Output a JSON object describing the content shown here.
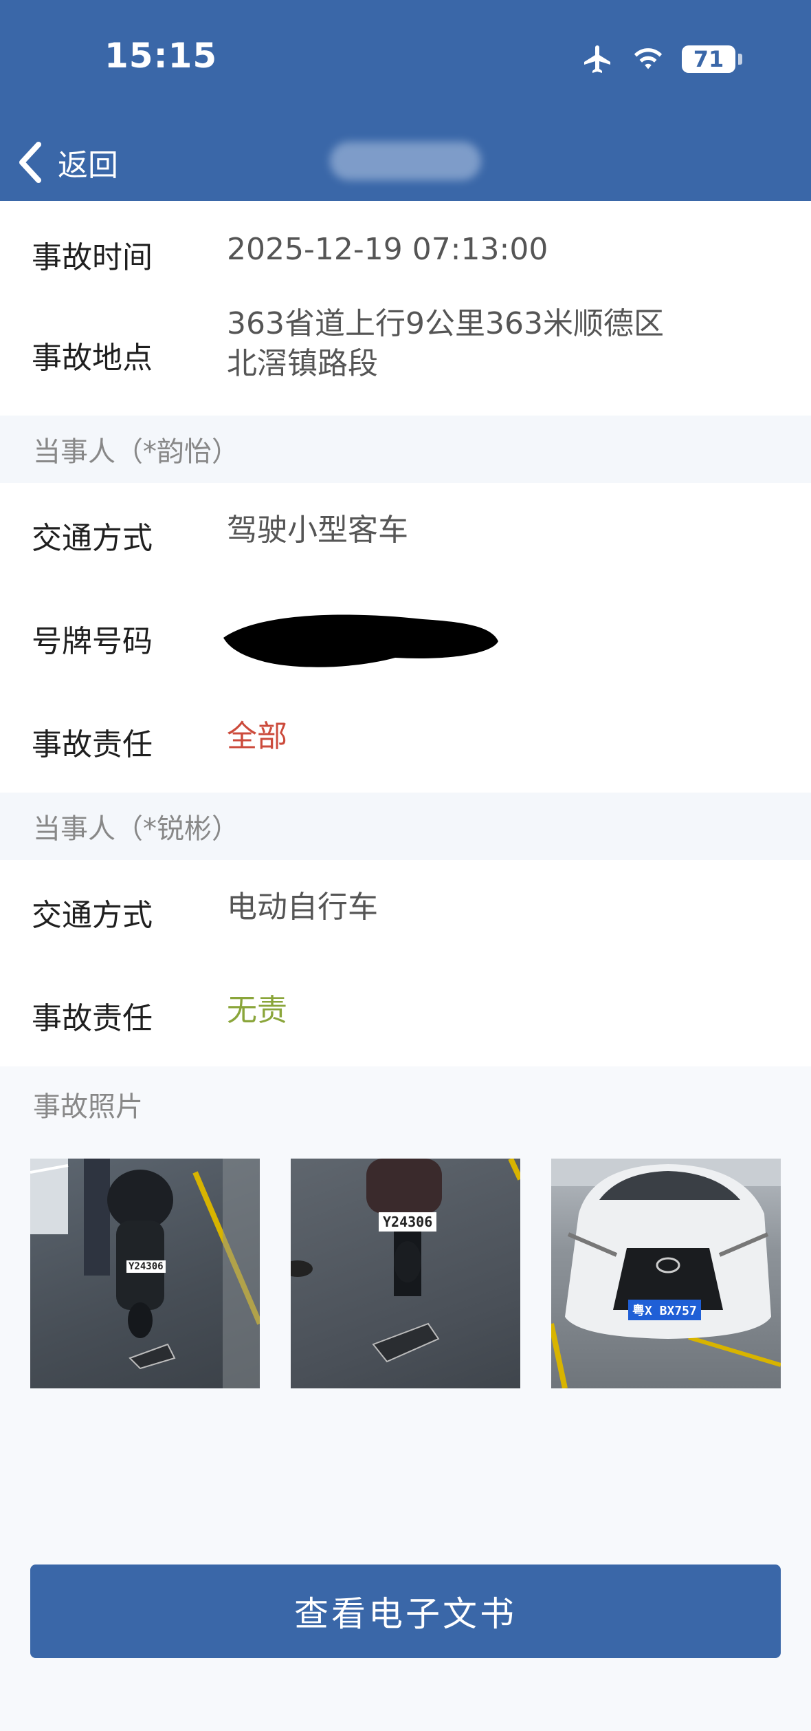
{
  "status_bar": {
    "time": "15:15",
    "battery": "71"
  },
  "nav": {
    "back_label": "返回"
  },
  "accident": {
    "time_label": "事故时间",
    "time_value": "2025-12-19 07:13:00",
    "location_label": "事故地点",
    "location_line1": "363省道上行9公里363米顺德区",
    "location_line2": "北滘镇路段"
  },
  "party1": {
    "header": "当事人（*韵怡）",
    "mode_label": "交通方式",
    "mode_value": "驾驶小型客车",
    "plate_label": "号牌号码",
    "liability_label": "事故责任",
    "liability_value": "全部"
  },
  "party2": {
    "header": "当事人（*锐彬）",
    "mode_label": "交通方式",
    "mode_value": "电动自行车",
    "liability_label": "事故责任",
    "liability_value": "无责"
  },
  "photos": {
    "header": "事故照片",
    "items": [
      {
        "plate": "Y24306"
      },
      {
        "plate": "Y24306"
      },
      {
        "plate": "粤X BX757"
      }
    ]
  },
  "footer": {
    "button_label": "查看电子文书"
  },
  "colors": {
    "brand": "#3a67a8",
    "liability_full": "#cc4b3c",
    "liability_none": "#8aa53a"
  }
}
